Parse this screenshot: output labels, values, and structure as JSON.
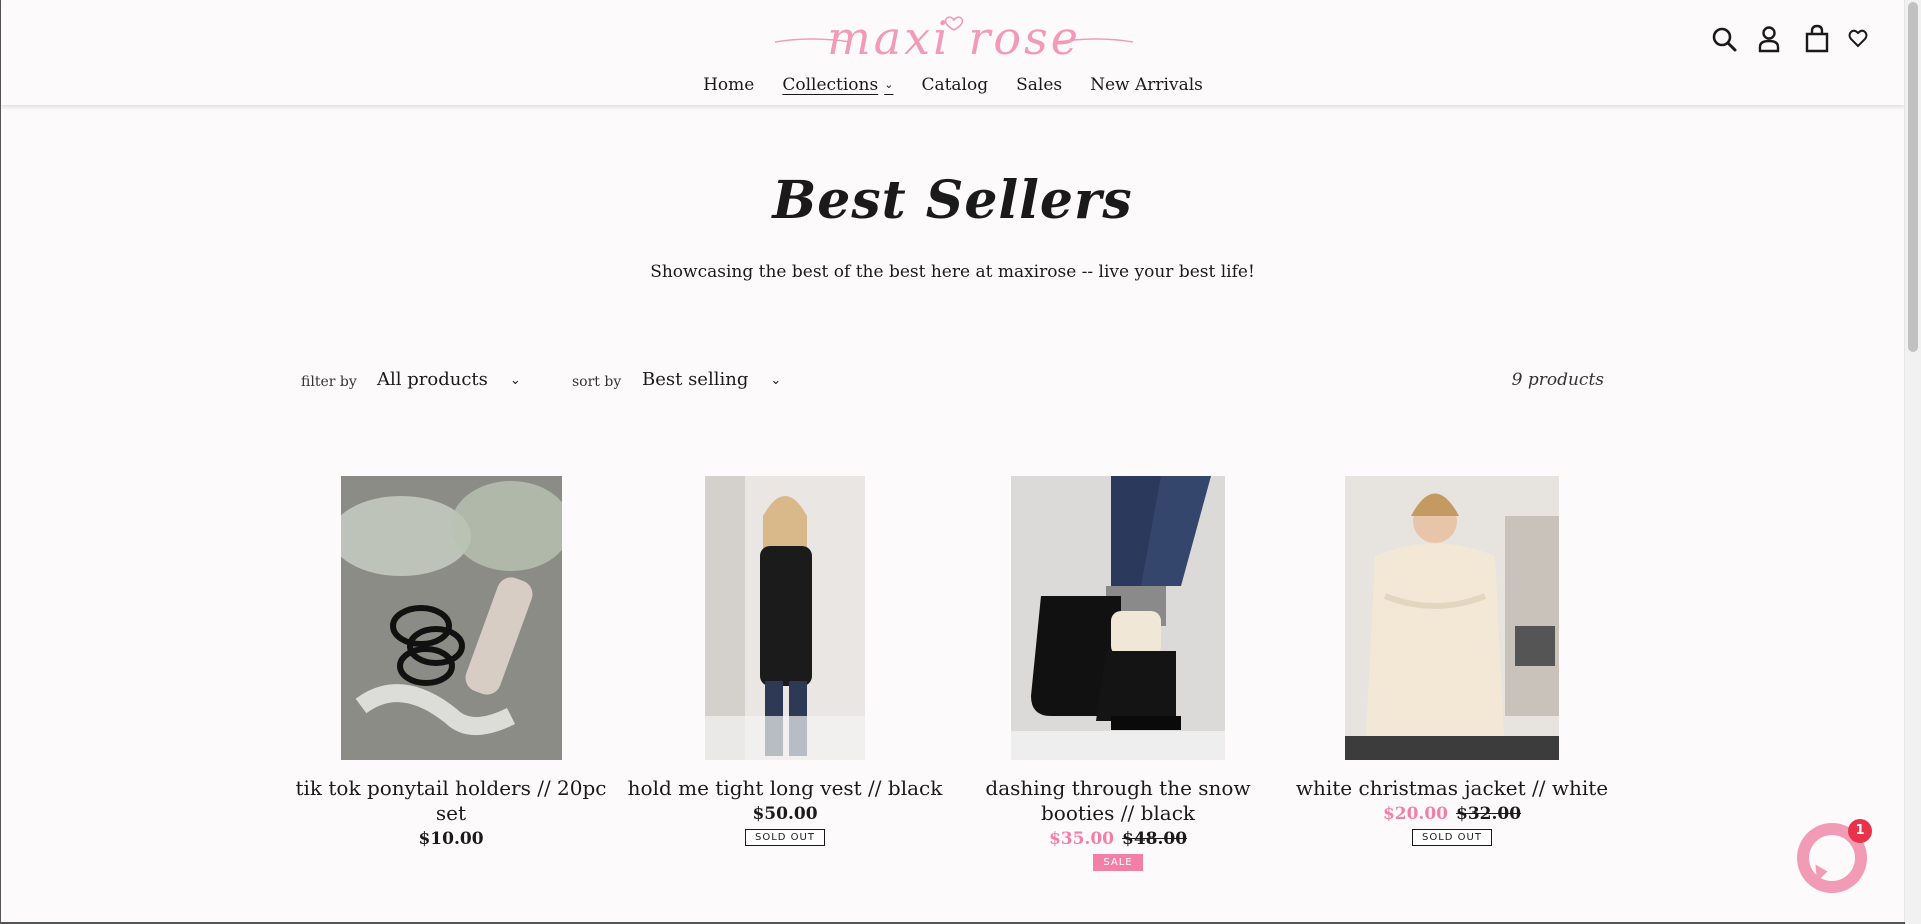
{
  "brand": {
    "logo_text": "maxi rose",
    "accent_color": "#f29bb6",
    "sale_color": "#f47fa6"
  },
  "nav": {
    "items": [
      {
        "label": "Home"
      },
      {
        "label": "Collections"
      },
      {
        "label": "Catalog"
      },
      {
        "label": "Sales"
      },
      {
        "label": "New Arrivals"
      }
    ]
  },
  "header_icons": [
    "search-icon",
    "account-icon",
    "cart-icon",
    "heart-icon"
  ],
  "page": {
    "title": "Best Sellers",
    "subtitle": "Showcasing the best of the best here at maxirose -- live your best life!"
  },
  "filters": {
    "filter_label": "filter by",
    "filter_value": "All products",
    "sort_label": "sort by",
    "sort_value": "Best selling",
    "count": "9 products"
  },
  "products": [
    {
      "title": "tik tok ponytail holders // 20pc set",
      "price": "$10.00",
      "sale_price": "",
      "old_price": "",
      "badge": ""
    },
    {
      "title": "hold me tight long vest // black",
      "price": "$50.00",
      "sale_price": "",
      "old_price": "",
      "badge": "SOLD OUT"
    },
    {
      "title": "dashing through the snow booties // black",
      "price": "",
      "sale_price": "$35.00",
      "old_price": "$48.00",
      "badge": "SALE"
    },
    {
      "title": "white christmas jacket // white",
      "price": "",
      "sale_price": "$20.00",
      "old_price": "$32.00",
      "badge": "SOLD OUT"
    }
  ],
  "chat": {
    "unread_count": "1"
  }
}
